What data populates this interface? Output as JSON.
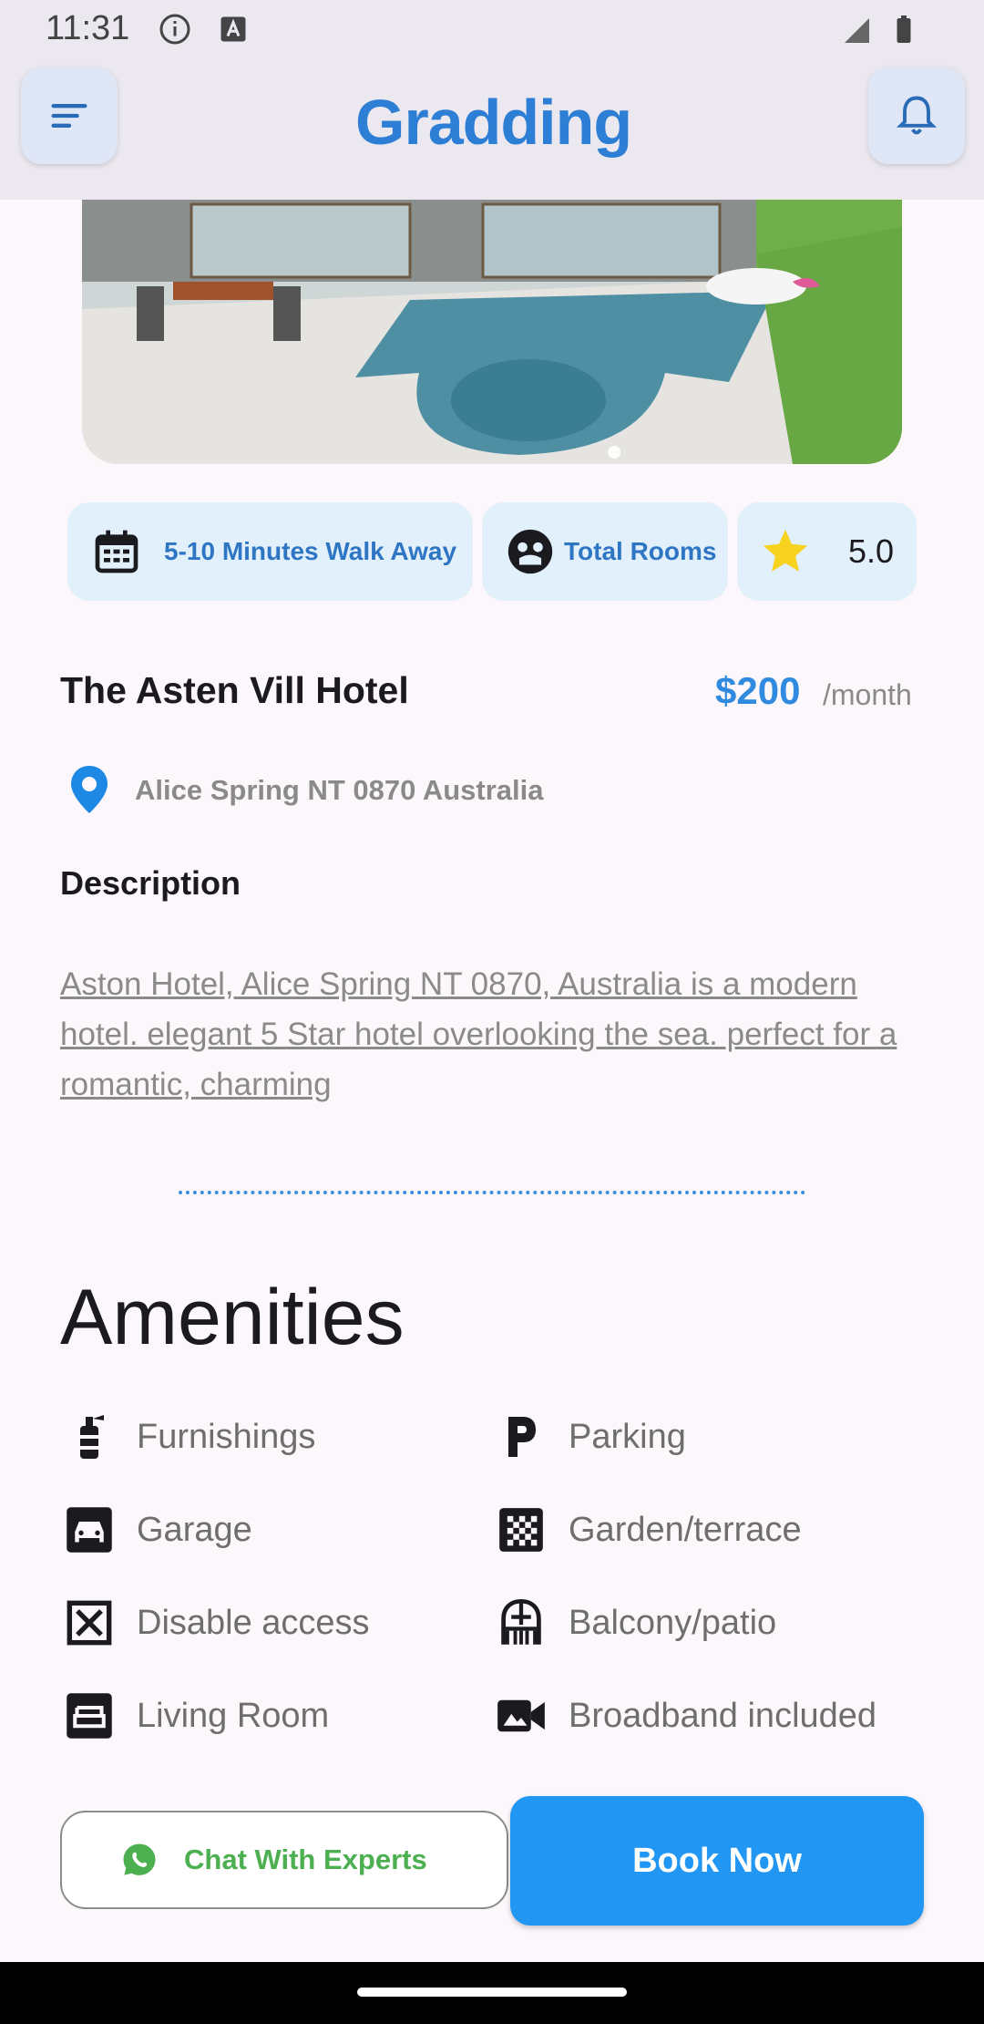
{
  "status_bar": {
    "time": "11:31"
  },
  "header": {
    "logo_text": "Gradding"
  },
  "chips": [
    {
      "label": "5-10 Minutes Walk Away",
      "icon": "calendar-icon"
    },
    {
      "label": "Total Rooms",
      "icon": "face-icon"
    },
    {
      "label": "5.0",
      "icon": "star-icon"
    }
  ],
  "hotel": {
    "name": "The Asten Vill Hotel",
    "price": "$200",
    "price_unit": "/month",
    "address": "Alice Spring NT 0870 Australia"
  },
  "description": {
    "title": "Description",
    "text": "Aston Hotel, Alice Spring NT 0870, Australia is a modern hotel. elegant 5 Star hotel overlooking the sea. perfect for a romantic, charming"
  },
  "amenities": {
    "title": "Amenities",
    "items": [
      {
        "label": "Furnishings",
        "icon": "fire-extinguisher-icon"
      },
      {
        "label": "Parking",
        "icon": "parking-icon"
      },
      {
        "label": "Garage",
        "icon": "car-icon"
      },
      {
        "label": "Garden/terrace",
        "icon": "checkerboard-icon"
      },
      {
        "label": "Disable access",
        "icon": "x-box-icon"
      },
      {
        "label": "Balcony/patio",
        "icon": "balcony-icon"
      },
      {
        "label": "Living Room",
        "icon": "sofa-icon"
      },
      {
        "label": "Broadband included",
        "icon": "video-camera-icon"
      }
    ]
  },
  "actions": {
    "chat_label": "Chat With Experts",
    "book_label": "Book Now"
  },
  "colors": {
    "accent": "#2196f3",
    "chip_bg": "#e1f0fb",
    "chat_green": "#4caf50"
  }
}
